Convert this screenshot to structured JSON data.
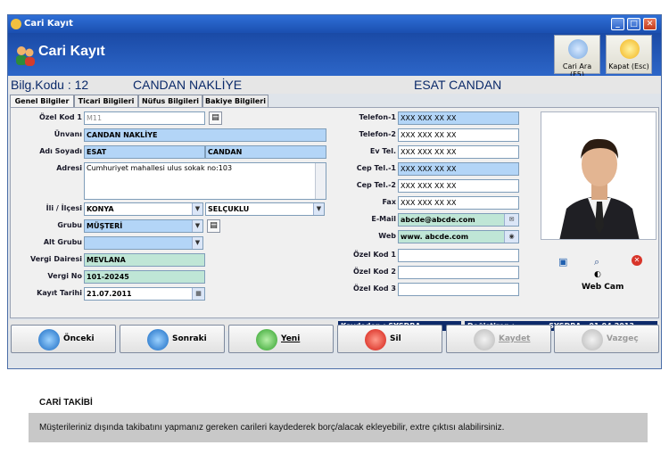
{
  "window": {
    "title": "Cari Kayıt"
  },
  "header": {
    "title": "Cari Kayıt",
    "search_button": "Cari Ara (F5)",
    "close_button": "Kapat (Esc)"
  },
  "info": {
    "code_label": "Bilg.Kodu : 12",
    "company": "CANDAN NAKLİYE",
    "person": "ESAT CANDAN"
  },
  "tabs": [
    "Genel Bilgiler",
    "Ticari Bilgileri",
    "Nüfus Bilgileri",
    "Bakiye Bilgileri"
  ],
  "form_left": {
    "ozel_kod1": {
      "label": "Özel Kod 1",
      "value": "M11"
    },
    "unvani": {
      "label": "Ünvanı",
      "value": "CANDAN NAKLİYE"
    },
    "adi_soyadi": {
      "label": "Adı Soyadı",
      "first": "ESAT",
      "last": "CANDAN"
    },
    "adresi": {
      "label": "Adresi",
      "value": "Cumhuriyet mahallesi ulus sokak no:103"
    },
    "il_ilce": {
      "label": "İli / İlçesi",
      "il": "KONYA",
      "ilce": "SELÇUKLU"
    },
    "grubu": {
      "label": "Grubu",
      "value": "MÜŞTERİ"
    },
    "alt_grubu": {
      "label": "Alt Grubu",
      "value": ""
    },
    "vergi_dairesi": {
      "label": "Vergi Dairesi",
      "value": "MEVLANA"
    },
    "vergi_no": {
      "label": "Vergi No",
      "value": "101-20245"
    },
    "kayit_tarihi": {
      "label": "Kayıt Tarihi",
      "value": "21.07.2011"
    }
  },
  "form_right": {
    "telefon1": {
      "label": "Telefon-1",
      "value": "XXX XXX XX XX"
    },
    "telefon2": {
      "label": "Telefon-2",
      "value": "XXX XXX XX XX"
    },
    "ev_tel": {
      "label": "Ev Tel.",
      "value": "XXX XXX XX XX"
    },
    "cep_tel1": {
      "label": "Cep Tel.-1",
      "value": "XXX XXX XX XX"
    },
    "cep_tel2": {
      "label": "Cep Tel.-2",
      "value": "XXX XXX XX XX"
    },
    "fax": {
      "label": "Fax",
      "value": "XXX XXX XX XX"
    },
    "email": {
      "label": "E-Mail",
      "value": "abcde@abcde.com"
    },
    "web": {
      "label": "Web",
      "value": "www. abcde.com"
    },
    "ozel_kod1": {
      "label": "Özel Kod 1",
      "value": ""
    },
    "ozel_kod2": {
      "label": "Özel Kod 2",
      "value": ""
    },
    "ozel_kod3": {
      "label": "Özel Kod 3",
      "value": ""
    }
  },
  "photo": {
    "webcam_label": "Web Cam"
  },
  "status": {
    "saved_by": "Kaydeden : SYSDBA",
    "modified_label": "Değiştiren :",
    "modified_value": "SYSDBA - 01.04.2013"
  },
  "buttons": {
    "prev": "Önceki",
    "next": "Sonraki",
    "new": "Yeni",
    "delete": "Sil",
    "save": "Kaydet",
    "cancel": "Vazgeç"
  },
  "caption": {
    "title": "CARİ TAKİBİ",
    "description": "Müşterileriniz dışında takibatını yapmanız gereken carileri kaydederek borç/alacak ekleyebilir, extre çıktısı alabilirsiniz."
  },
  "colors": {
    "accent": "#1a4aa6",
    "field_blue": "#b3d5f7",
    "field_green": "#bfe6d6"
  }
}
